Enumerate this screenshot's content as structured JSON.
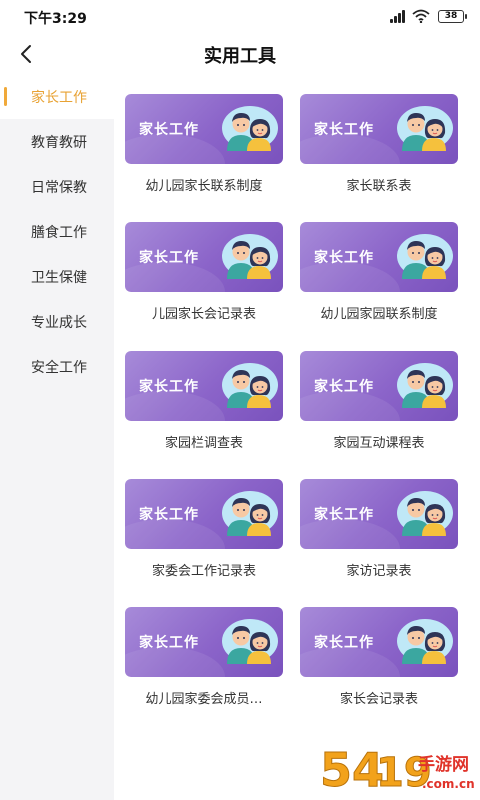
{
  "status_bar": {
    "time": "下午3:29",
    "battery": "38"
  },
  "nav": {
    "title": "实用工具"
  },
  "sidebar": {
    "items": [
      {
        "label": "家长工作",
        "active": true
      },
      {
        "label": "教育教研",
        "active": false
      },
      {
        "label": "日常保教",
        "active": false
      },
      {
        "label": "膳食工作",
        "active": false
      },
      {
        "label": "卫生保健",
        "active": false
      },
      {
        "label": "专业成长",
        "active": false
      },
      {
        "label": "安全工作",
        "active": false
      }
    ]
  },
  "cards": [
    {
      "banner": "家长工作",
      "label": "幼儿园家长联系制度"
    },
    {
      "banner": "家长工作",
      "label": "家长联系表"
    },
    {
      "banner": "家长工作",
      "label": "儿园家长会记录表"
    },
    {
      "banner": "家长工作",
      "label": "幼儿园家园联系制度"
    },
    {
      "banner": "家长工作",
      "label": "家园栏调查表"
    },
    {
      "banner": "家长工作",
      "label": "家园互动课程表"
    },
    {
      "banner": "家长工作",
      "label": "家委会工作记录表"
    },
    {
      "banner": "家长工作",
      "label": "家访记录表"
    },
    {
      "banner": "家长工作",
      "label": "幼儿园家委会成员…"
    },
    {
      "banner": "家长工作",
      "label": "家长会记录表"
    }
  ],
  "watermark": {
    "text": "5419手游网",
    "sub": ".com.cn"
  },
  "colors": {
    "accent": "#e8a233",
    "banner_purple": "#8b64c9",
    "sidebar_bg": "#f4f4f6"
  }
}
